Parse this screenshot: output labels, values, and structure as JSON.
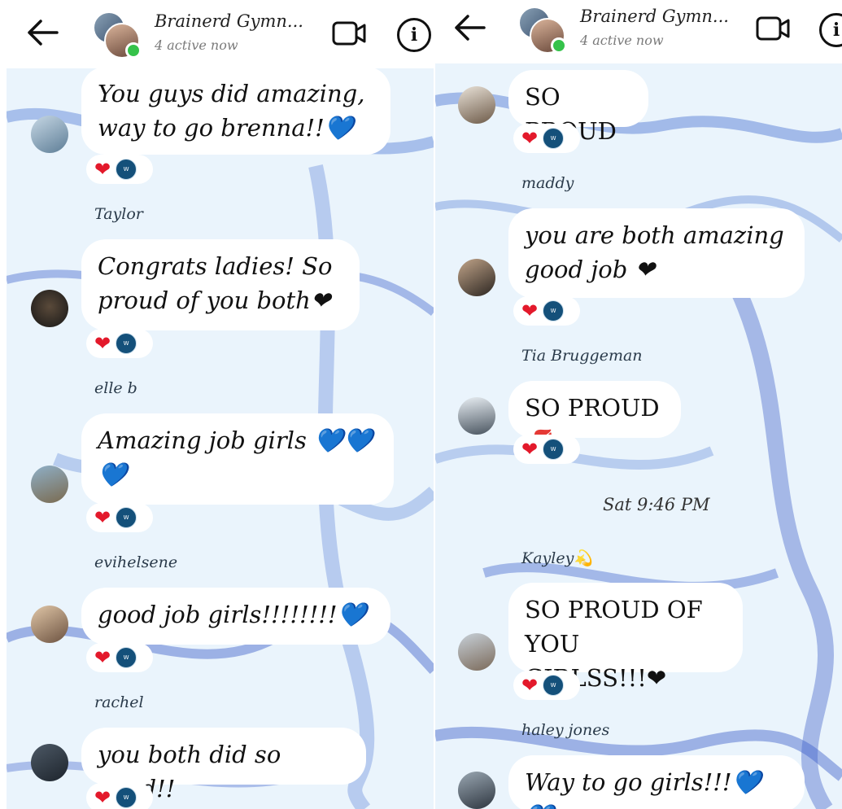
{
  "header": {
    "group_title": "Brainerd Gymn...",
    "active_status": "4 active now"
  },
  "colors": {
    "bubble": "#ffffff",
    "background": "#eaf4fc",
    "accent_blue": "#3c7ad8",
    "heart": "#e3192b",
    "online": "#35c24a"
  },
  "icons": {
    "back": "arrow-left-icon",
    "video": "video-camera-icon",
    "info": "info-icon",
    "reaction": "heart-icon",
    "team_badge": "team-badge-icon"
  },
  "info_glyph": "i",
  "left": {
    "messages": [
      {
        "sender": "",
        "text": "You guys did amazing,\nway to go brenna!!💙",
        "reactions": "❤"
      },
      {
        "sender": "Taylor",
        "text": "Congrats ladies! So\nproud of you both❤",
        "reactions": "❤"
      },
      {
        "sender": "elle b",
        "text": "Amazing job girls 💙💙\n💙",
        "reactions": "❤"
      },
      {
        "sender": "evihelsene",
        "text": "good job girls!!!!!!!!💙",
        "reactions": "❤"
      },
      {
        "sender": "rachel",
        "text": "you both did so good!!",
        "reactions": "❤"
      }
    ]
  },
  "right": {
    "messages": [
      {
        "sender": "",
        "text": "SO PROUD",
        "reactions": "❤"
      },
      {
        "sender": "maddy",
        "text": "you are both amazing\ngood job ❤",
        "reactions": "❤"
      },
      {
        "sender": "Tia Bruggeman",
        "text": "SO PROUD💋",
        "reactions": "❤"
      },
      {
        "sender": "Kayley💫",
        "text": "SO PROUD OF YOU\nGIRLSS!!!❤",
        "reactions": "❤"
      },
      {
        "sender": "haley jones",
        "text": "Way to go girls!!!💙💙",
        "reactions": ""
      }
    ],
    "timestamp": "Sat 9:46 PM"
  }
}
